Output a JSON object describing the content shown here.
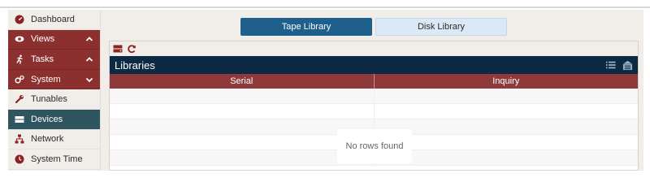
{
  "sidebar": {
    "items": [
      {
        "label": "Dashboard",
        "icon": "dashboard-icon"
      },
      {
        "label": "Views",
        "icon": "eye-icon",
        "state": "expanded-group"
      },
      {
        "label": "Tasks",
        "icon": "running-icon",
        "state": "expanded-group"
      },
      {
        "label": "System",
        "icon": "gears-icon",
        "state": "collapsed-group"
      },
      {
        "label": "Tunables",
        "icon": "wrench-icon"
      },
      {
        "label": "Devices",
        "icon": "hdd-icon",
        "state": "active"
      },
      {
        "label": "Network",
        "icon": "network-icon"
      },
      {
        "label": "System Time",
        "icon": "clock-icon"
      }
    ]
  },
  "tabs": [
    {
      "label": "Tape Library",
      "active": true
    },
    {
      "label": "Disk Library",
      "active": false
    }
  ],
  "panel": {
    "title": "Libraries",
    "toolbar": [
      "add-device-icon",
      "refresh-icon"
    ],
    "header_icons": [
      "list-icon",
      "library-icon"
    ],
    "columns": [
      "Serial",
      "Inquiry"
    ],
    "empty_message": "No rows found"
  },
  "colors": {
    "sidebar_group": "#8c2f2f",
    "sidebar_active": "#2f5560",
    "tab_active": "#1f5f8b",
    "tab_inactive": "#dbe8f6",
    "panel_header": "#0c2a44",
    "table_header": "#8e3a3a",
    "icon_red": "#8c2222"
  }
}
